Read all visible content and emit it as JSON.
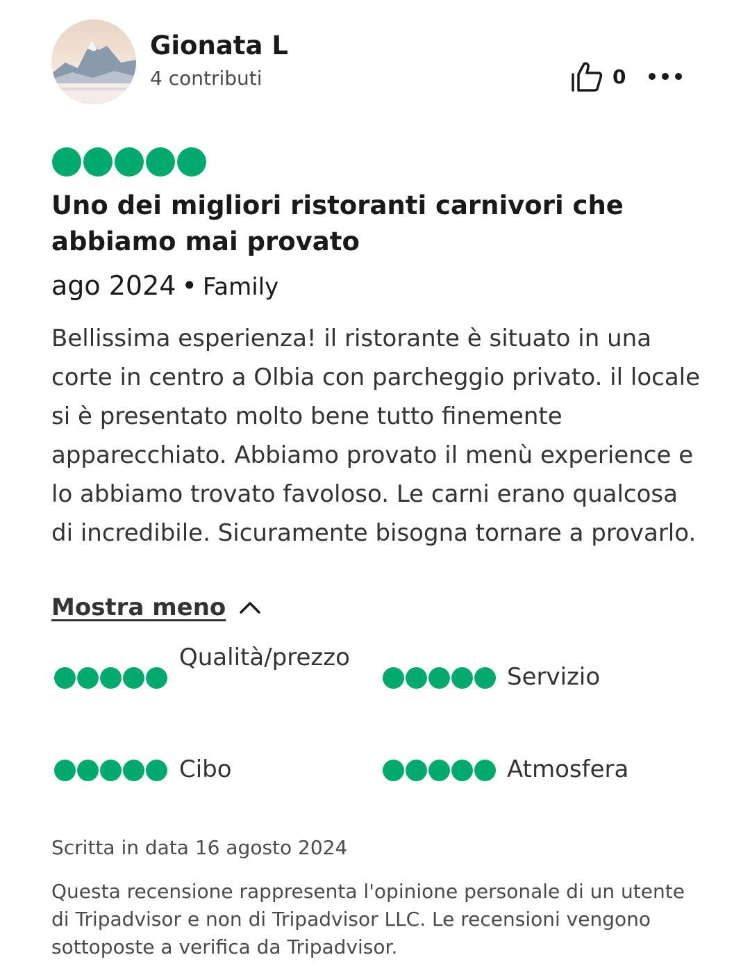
{
  "colors": {
    "bubble": "#00aa6c",
    "text": "#1a1a1a",
    "muted": "#4a4a4a"
  },
  "reviewer": {
    "name": "Gionata L",
    "contributions": "4 contributi",
    "avatar_icon": "mountain-landscape-avatar"
  },
  "actions": {
    "helpful_icon": "thumbs-up-icon",
    "helpful_count": "0",
    "more_icon": "more-options-icon"
  },
  "review": {
    "rating": 5,
    "rating_max": 5,
    "title": "Uno dei migliori ristoranti carnivori che abbiamo mai provato",
    "visit_date": "ago 2024",
    "separator": "•",
    "trip_type": "Family",
    "text": "Bellissima esperienza! il ristorante è situato in una corte in centro a Olbia con parcheggio privato. il locale si è presentato molto bene tutto finemente apparecchiato. Abbiamo provato il menù experience e lo abbiamo trovato favoloso. Le carni erano qualcosa di incredibile. Sicuramente bisogna tornare a provarlo.",
    "toggle_label": "Mostra meno",
    "toggle_icon": "chevron-up-icon"
  },
  "subratings": [
    {
      "label": "Qualità/prezzo",
      "rating": 5
    },
    {
      "label": "Servizio",
      "rating": 5
    },
    {
      "label": "Cibo",
      "rating": 5
    },
    {
      "label": "Atmosfera",
      "rating": 5
    }
  ],
  "footer": {
    "written_date": "Scritta in data 16 agosto 2024",
    "disclaimer": "Questa recensione rappresenta l'opinione personale di un utente di Tripadvisor e non di Tripadvisor LLC. Le recensioni vengono sottoposte a verifica da Tripadvisor."
  }
}
